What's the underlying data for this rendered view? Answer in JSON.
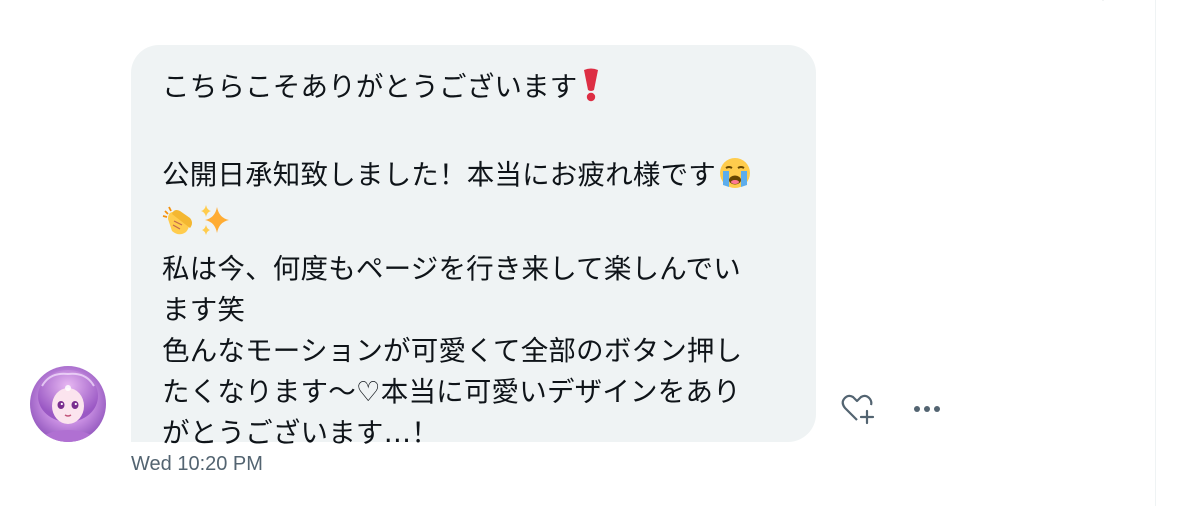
{
  "conversation": {
    "message": {
      "lines": [
        "こちらこそありがとうございます",
        "",
        "公開日承知致しました！本当にお疲れ様です",
        "",
        "私は今、何度もページを行き来して楽しんでい",
        "ます笑",
        "色んなモーションが可愛くて全部のボタン押し",
        "たくなります〜♡本当に可愛いデザインをあり",
        "がとうございます…！"
      ],
      "emojis": {
        "line1": "heavy-exclamation-icon",
        "line3": "loudly-crying-face-icon",
        "line4": [
          "clapping-hands-icon",
          "sparkles-icon"
        ]
      },
      "timestamp": "Wed 10:20 PM"
    },
    "actions": {
      "react_icon": "heart-plus-icon",
      "more_icon": "more-horizontal-icon"
    }
  },
  "colors": {
    "bubble_background": "#eff3f4",
    "text": "#0f1419",
    "secondary_text": "#536471"
  }
}
